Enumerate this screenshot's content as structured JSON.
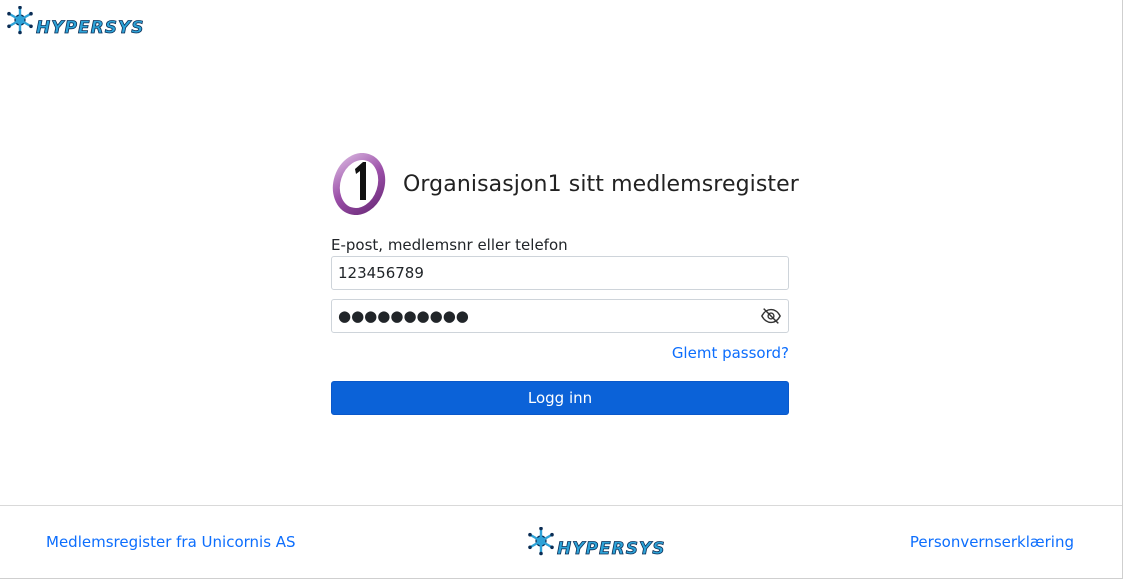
{
  "header": {
    "logo_text": "HYPERSYS",
    "logo_icon": "snowflake-gear-icon"
  },
  "login": {
    "org_title": "Organisasjon1 sitt medlemsregister",
    "org_logo_icon": "organisasjon1-logo-icon",
    "username_label": "E-post, medlemsnr eller telefon",
    "username_value": "123456789",
    "password_value": "●●●●●●●●●●",
    "password_toggle_icon": "eye-slash-icon",
    "forgot_link": "Glemt passord?",
    "login_button": "Logg inn"
  },
  "footer": {
    "left_link": "Medlemsregister fra Unicornis AS",
    "logo_text": "HYPERSYS",
    "right_link": "Personvernserklæring"
  },
  "colors": {
    "primary": "#0b62d8",
    "link": "#0d6efd",
    "logo_blue": "#2ea3d8",
    "logo_dark": "#0b2d55",
    "org_purple": "#9b4fa8"
  }
}
